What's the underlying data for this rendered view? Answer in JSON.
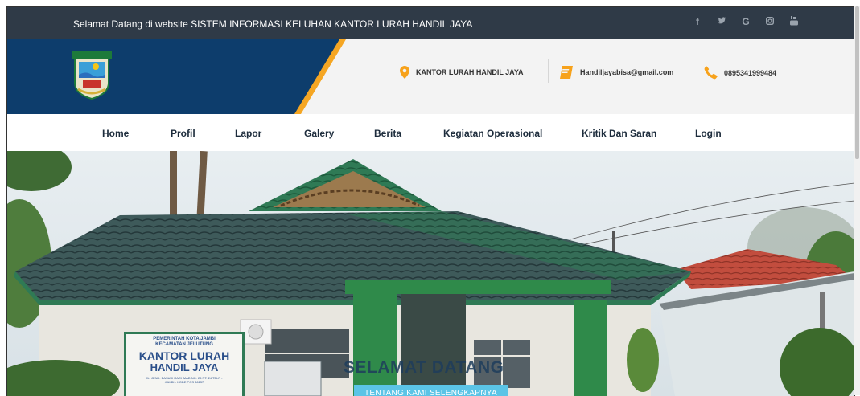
{
  "topbar": {
    "welcome": "Selamat Datang di website SISTEM INFORMASI KELUHAN KANTOR LURAH HANDIL JAYA",
    "social_icons": [
      "facebook-icon",
      "twitter-icon",
      "google-icon",
      "instagram-icon",
      "youtube-icon"
    ],
    "social_glyphs": {
      "facebook": "f",
      "twitter": "🐦",
      "google": "G",
      "instagram": "◎",
      "youtube": "▶"
    }
  },
  "header": {
    "logo_text": "KOTA JAMBI",
    "address": "KANTOR LURAH HANDIL JAYA",
    "email": "Handiljayabisa@gmail.com",
    "phone": "0895341999484",
    "colors": {
      "navy": "#0d3d6c",
      "accent": "#f5a623",
      "icon_orange": "#f7a21b"
    }
  },
  "nav": {
    "items": [
      "Home",
      "Profil",
      "Lapor",
      "Galery",
      "Berita",
      "Kegiatan Operasional",
      "Kritik Dan Saran",
      "Login"
    ]
  },
  "hero": {
    "title": "SELAMAT DATANG",
    "button": "TENTANG KAMI SELENGKAPNYA",
    "sign": {
      "line1": "PEMERINTAH KOTA JAMBI",
      "line2": "KECAMATAN JELUTUNG",
      "line3": "KANTOR LURAH",
      "line4": "HANDIL JAYA",
      "line5": "JL. JEND. BASUKI RACHMAD NO. 26 RT. 24 TELP -",
      "line6": "JAMBI - KODE POS 36137"
    },
    "button_color": "#5bc4e6"
  }
}
